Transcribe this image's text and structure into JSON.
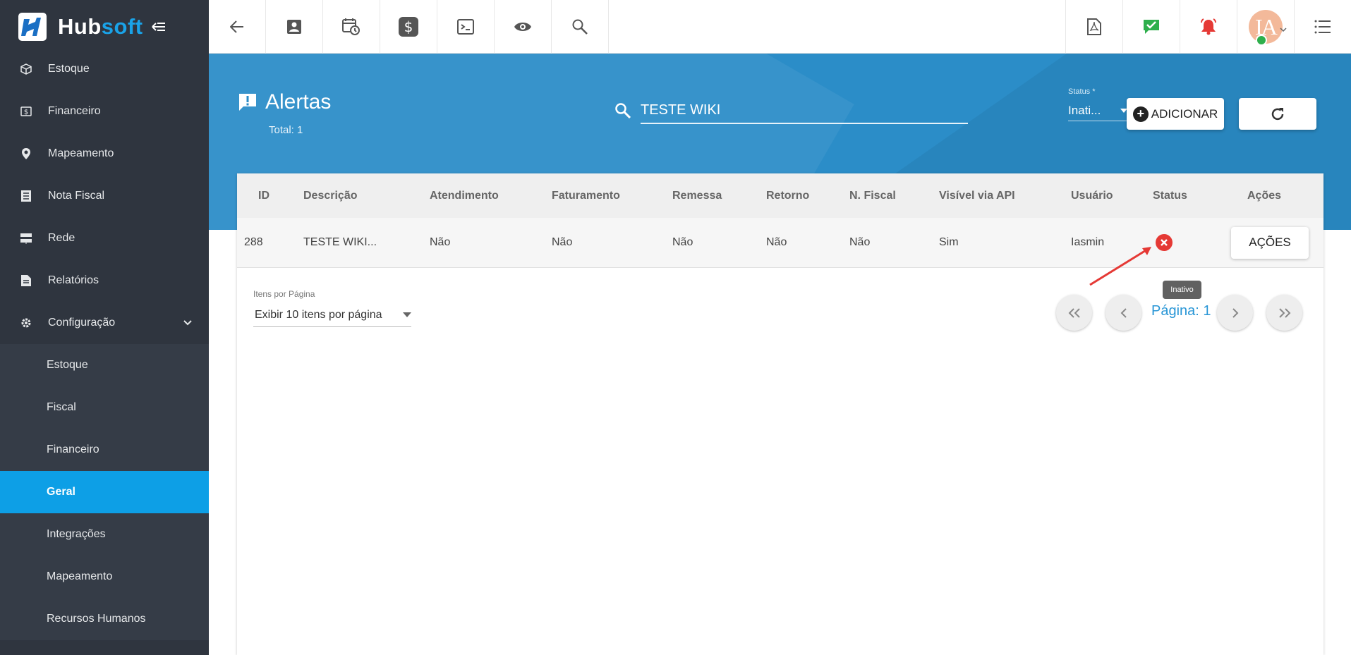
{
  "brand": {
    "name_part1": "Hub",
    "name_part2": "soft"
  },
  "sidebar": {
    "items": [
      {
        "label": "Estoque",
        "icon": "box-icon"
      },
      {
        "label": "Financeiro",
        "icon": "money-icon"
      },
      {
        "label": "Mapeamento",
        "icon": "map-pin-icon"
      },
      {
        "label": "Nota Fiscal",
        "icon": "invoice-icon"
      },
      {
        "label": "Rede",
        "icon": "network-icon"
      },
      {
        "label": "Relatórios",
        "icon": "report-icon"
      },
      {
        "label": "Configuração",
        "icon": "gear-icon"
      }
    ],
    "submenu": [
      {
        "label": "Estoque"
      },
      {
        "label": "Fiscal"
      },
      {
        "label": "Financeiro"
      },
      {
        "label": "Geral",
        "active": true
      },
      {
        "label": "Integrações"
      },
      {
        "label": "Mapeamento"
      },
      {
        "label": "Recursos Humanos"
      }
    ]
  },
  "topbar": {
    "icons": [
      "back-arrow-icon",
      "contact-card-icon",
      "calendar-clock-icon",
      "dollar-icon",
      "terminal-icon",
      "eye-icon",
      "search-icon"
    ],
    "right_icons": [
      "pdf-icon",
      "checked-message-icon",
      "alarm-bell-icon"
    ],
    "avatar_initials": "IA"
  },
  "page": {
    "title": "Alertas",
    "total": "Total: 1",
    "search_value": "TESTE WIKI",
    "status_label": "Status *",
    "status_value": "Inati...",
    "add_button": "ADICIONAR"
  },
  "table": {
    "headers": [
      "ID",
      "Descrição",
      "Atendimento",
      "Faturamento",
      "Remessa",
      "Retorno",
      "N. Fiscal",
      "Visível via API",
      "Usuário",
      "Status",
      "Ações"
    ],
    "rows": [
      {
        "id": "288",
        "descricao": "TESTE WIKI...",
        "atendimento": "Não",
        "faturamento": "Não",
        "remessa": "Não",
        "retorno": "Não",
        "fiscal": "Não",
        "api": "Sim",
        "usuario": "Iasmin",
        "status": "inactive",
        "acoes": "AÇÕES"
      }
    ]
  },
  "tooltip": "Inativo",
  "pagination": {
    "per_page_label": "Itens por Página",
    "per_page_value": "Exibir 10 itens por página",
    "page_label": "Página: 1"
  },
  "colors": {
    "accent": "#0d9fe6",
    "hero": "#2b8dc8",
    "sidebar": "#2f353f",
    "danger": "#e53935"
  }
}
